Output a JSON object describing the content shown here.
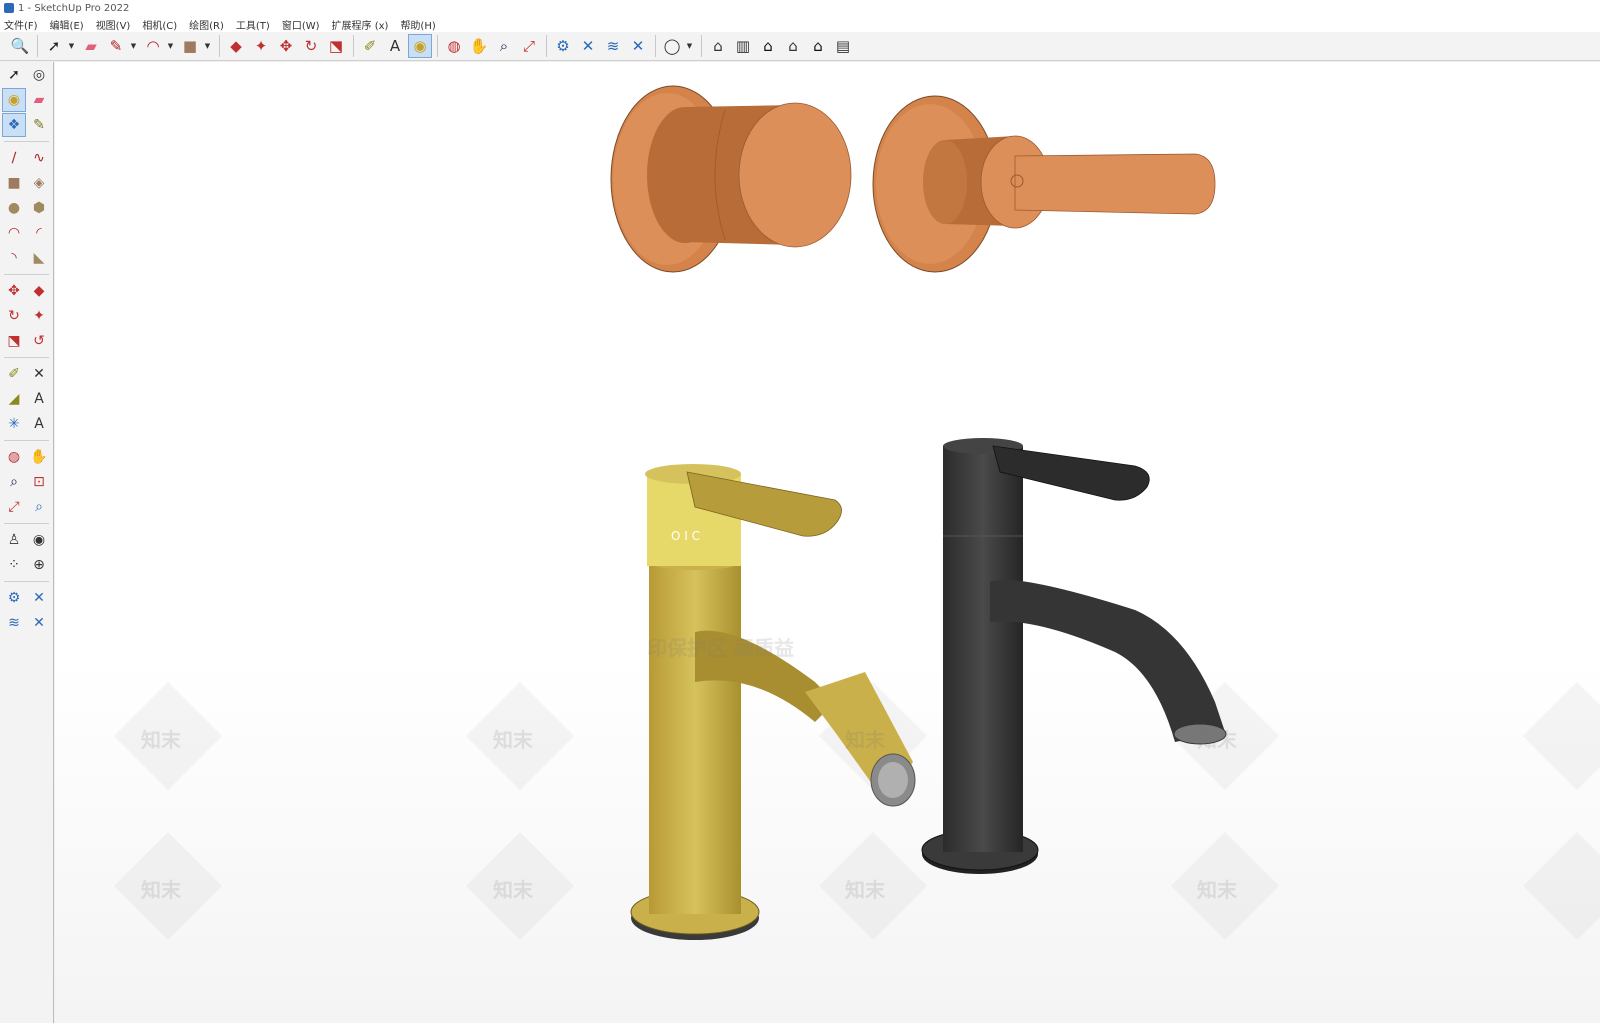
{
  "window": {
    "title": "1 - SketchUp Pro 2022"
  },
  "menu": [
    "文件(F)",
    "编辑(E)",
    "视图(V)",
    "相机(C)",
    "绘图(R)",
    "工具(T)",
    "窗口(W)",
    "扩展程序 (x)",
    "帮助(H)"
  ],
  "toolbar": {
    "groups": [
      [
        {
          "icon": "zoom-icon",
          "glyph": "🔍",
          "color": "#333"
        }
      ],
      [
        {
          "icon": "select-icon",
          "glyph": "➚",
          "color": "#222",
          "drop": true
        },
        {
          "icon": "eraser-icon",
          "glyph": "▰",
          "color": "#e0607a"
        },
        {
          "icon": "pencil-line-icon",
          "glyph": "✎",
          "color": "#b02020",
          "drop": true
        },
        {
          "icon": "arc-icon",
          "glyph": "◠",
          "color": "#b02020",
          "drop": true
        },
        {
          "icon": "rectangle-icon",
          "glyph": "■",
          "color": "#a07a60",
          "drop": true
        }
      ],
      [
        {
          "icon": "push-pull-icon",
          "glyph": "◆",
          "color": "#c03030"
        },
        {
          "icon": "follow-me-icon",
          "glyph": "✦",
          "color": "#c03030"
        },
        {
          "icon": "move-icon",
          "glyph": "✥",
          "color": "#c03030"
        },
        {
          "icon": "rotate-icon",
          "glyph": "↻",
          "color": "#c03030"
        },
        {
          "icon": "scale-icon",
          "glyph": "⬔",
          "color": "#c03030"
        }
      ],
      [
        {
          "icon": "tape-measure-icon",
          "glyph": "✐",
          "color": "#8a8a20"
        },
        {
          "icon": "text-icon",
          "glyph": "A",
          "color": "#333"
        },
        {
          "icon": "paint-bucket-icon",
          "glyph": "◉",
          "color": "#c8a020",
          "active": true
        }
      ],
      [
        {
          "icon": "orbit-icon",
          "glyph": "◍",
          "color": "#c03030"
        },
        {
          "icon": "pan-icon",
          "glyph": "✋",
          "color": "#c8a050"
        },
        {
          "icon": "zoom-tool-icon",
          "glyph": "⌕",
          "color": "#225"
        },
        {
          "icon": "zoom-extents-icon",
          "glyph": "⤢",
          "color": "#c03030"
        }
      ],
      [
        {
          "icon": "warehouse-icon",
          "glyph": "⚙",
          "color": "#2a6ab8"
        },
        {
          "icon": "extension-warehouse-icon",
          "glyph": "✕",
          "color": "#2a6ab8"
        },
        {
          "icon": "layout-icon",
          "glyph": "≋",
          "color": "#2a6ab8"
        },
        {
          "icon": "share-model-icon",
          "glyph": "✕",
          "color": "#2a6ab8"
        }
      ],
      [
        {
          "icon": "account-icon",
          "glyph": "◯",
          "color": "#333",
          "drop": true
        }
      ],
      [
        {
          "icon": "iso-view-icon",
          "glyph": "⌂",
          "color": "#333"
        },
        {
          "icon": "top-view-icon",
          "glyph": "▥",
          "color": "#333"
        },
        {
          "icon": "front-view-icon",
          "glyph": "⌂",
          "color": "#111"
        },
        {
          "icon": "right-view-icon",
          "glyph": "⌂",
          "color": "#333"
        },
        {
          "icon": "back-view-icon",
          "glyph": "⌂",
          "color": "#111"
        },
        {
          "icon": "left-view-icon",
          "glyph": "▤",
          "color": "#333"
        }
      ]
    ]
  },
  "lefttools": [
    [
      {
        "icon": "select-icon",
        "glyph": "➚",
        "color": "#222"
      },
      {
        "icon": "orbit-icon",
        "glyph": "◎",
        "color": "#333"
      }
    ],
    [
      {
        "icon": "paint-bucket-icon",
        "glyph": "◉",
        "color": "#c8a020",
        "active": true
      },
      {
        "icon": "eraser-icon",
        "glyph": "▰",
        "color": "#e0607a"
      }
    ],
    [
      {
        "icon": "make-component-icon",
        "glyph": "❖",
        "color": "#2a6ab8",
        "active": true
      },
      {
        "icon": "tag-icon",
        "glyph": "✎",
        "color": "#7a7a20"
      }
    ],
    "sep",
    [
      {
        "icon": "line-icon",
        "glyph": "∕",
        "color": "#b02020"
      },
      {
        "icon": "freehand-icon",
        "glyph": "∿",
        "color": "#b02020"
      }
    ],
    [
      {
        "icon": "rectangle-icon",
        "glyph": "■",
        "color": "#a07a60"
      },
      {
        "icon": "rotated-rectangle-icon",
        "glyph": "◈",
        "color": "#a07a60"
      }
    ],
    [
      {
        "icon": "circle-icon",
        "glyph": "●",
        "color": "#a08a60"
      },
      {
        "icon": "polygon-icon",
        "glyph": "⬢",
        "color": "#a08a60"
      }
    ],
    [
      {
        "icon": "arc-icon",
        "glyph": "◠",
        "color": "#b02020"
      },
      {
        "icon": "two-point-arc-icon",
        "glyph": "◜",
        "color": "#b02020"
      }
    ],
    [
      {
        "icon": "three-point-arc-icon",
        "glyph": "◝",
        "color": "#b02020"
      },
      {
        "icon": "pie-icon",
        "glyph": "◣",
        "color": "#a08a60"
      }
    ],
    "sep",
    [
      {
        "icon": "move-icon",
        "glyph": "✥",
        "color": "#c03030"
      },
      {
        "icon": "push-pull-icon",
        "glyph": "◆",
        "color": "#c03030"
      }
    ],
    [
      {
        "icon": "rotate-icon",
        "glyph": "↻",
        "color": "#c03030"
      },
      {
        "icon": "follow-me-icon",
        "glyph": "✦",
        "color": "#c03030"
      }
    ],
    [
      {
        "icon": "scale-icon",
        "glyph": "⬔",
        "color": "#c03030"
      },
      {
        "icon": "offset-icon",
        "glyph": "↺",
        "color": "#c03030"
      }
    ],
    "sep",
    [
      {
        "icon": "tape-measure-icon",
        "glyph": "✐",
        "color": "#8a8a20"
      },
      {
        "icon": "dimension-icon",
        "glyph": "✕",
        "color": "#333"
      }
    ],
    [
      {
        "icon": "protractor-icon",
        "glyph": "◢",
        "color": "#8a8a20"
      },
      {
        "icon": "text-icon",
        "glyph": "A",
        "color": "#333"
      }
    ],
    [
      {
        "icon": "axes-icon",
        "glyph": "✳",
        "color": "#2a6ab8"
      },
      {
        "icon": "3d-text-icon",
        "glyph": "A",
        "color": "#333"
      }
    ],
    "sep",
    [
      {
        "icon": "orbit-icon",
        "glyph": "◍",
        "color": "#c03030"
      },
      {
        "icon": "pan-icon",
        "glyph": "✋",
        "color": "#c8a050"
      }
    ],
    [
      {
        "icon": "zoom-icon",
        "glyph": "⌕",
        "color": "#225"
      },
      {
        "icon": "zoom-window-icon",
        "glyph": "⊡",
        "color": "#c03030"
      }
    ],
    [
      {
        "icon": "zoom-extents-icon",
        "glyph": "⤢",
        "color": "#c03030"
      },
      {
        "icon": "previous-view-icon",
        "glyph": "⌕",
        "color": "#2a6ab8"
      }
    ],
    "sep",
    [
      {
        "icon": "position-camera-icon",
        "glyph": "♙",
        "color": "#333"
      },
      {
        "icon": "look-around-icon",
        "glyph": "◉",
        "color": "#333"
      }
    ],
    [
      {
        "icon": "walk-icon",
        "glyph": "⁘",
        "color": "#333"
      },
      {
        "icon": "section-plane-icon",
        "glyph": "⊕",
        "color": "#333"
      }
    ],
    "sep",
    [
      {
        "icon": "warehouse-icon",
        "glyph": "⚙",
        "color": "#2a6ab8"
      },
      {
        "icon": "extension-warehouse-icon",
        "glyph": "✕",
        "color": "#2a6ab8"
      }
    ],
    [
      {
        "icon": "layout-icon",
        "glyph": "≋",
        "color": "#2a6ab8"
      },
      {
        "icon": "share-model-icon",
        "glyph": "✕",
        "color": "#2a6ab8"
      }
    ]
  ],
  "scene": {
    "copper_color": "#d98a52",
    "brass_color": "#c9b04a",
    "black_color": "#3a3a3a",
    "brass_ring_text": "O I C",
    "watermark_brand": "知末",
    "watermark_banner": "印保护区 画质益"
  }
}
